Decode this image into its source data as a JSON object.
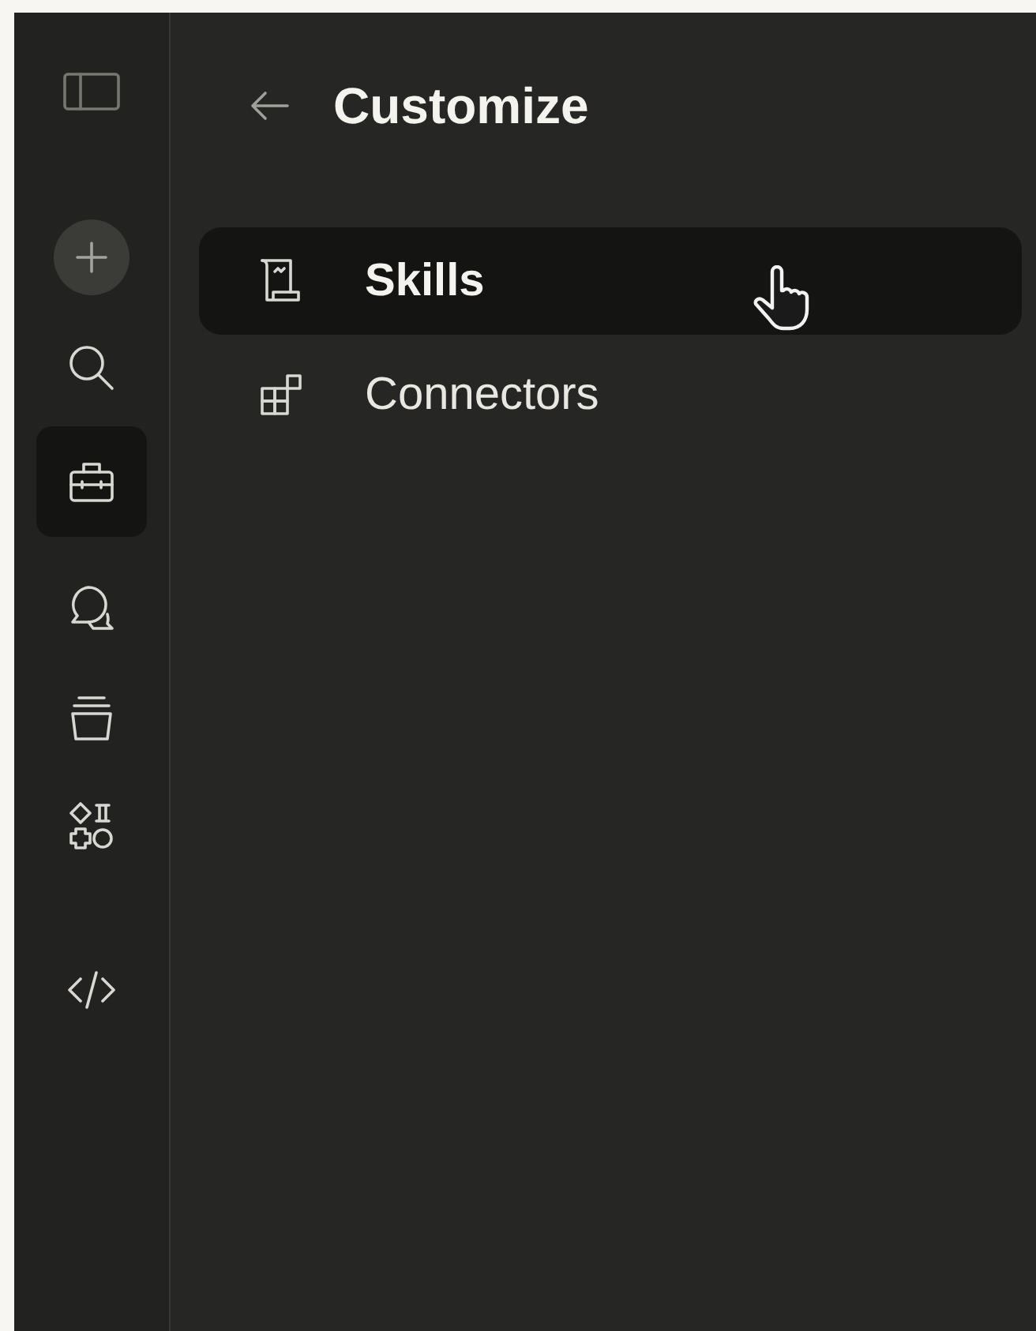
{
  "rail": [
    {
      "kind": "sidebar",
      "selected": false
    },
    {
      "kind": "new",
      "selected": false
    },
    {
      "kind": "search",
      "selected": false
    },
    {
      "kind": "toolkit",
      "selected": true
    },
    {
      "kind": "chats",
      "selected": false
    },
    {
      "kind": "projects",
      "selected": false
    },
    {
      "kind": "artifacts",
      "selected": false
    },
    {
      "kind": "code",
      "selected": false
    }
  ],
  "header": {
    "title": "Customize"
  },
  "menu": [
    {
      "kind": "skills",
      "label": "Skills",
      "selected": true
    },
    {
      "kind": "connectors",
      "label": "Connectors",
      "selected": false
    }
  ]
}
